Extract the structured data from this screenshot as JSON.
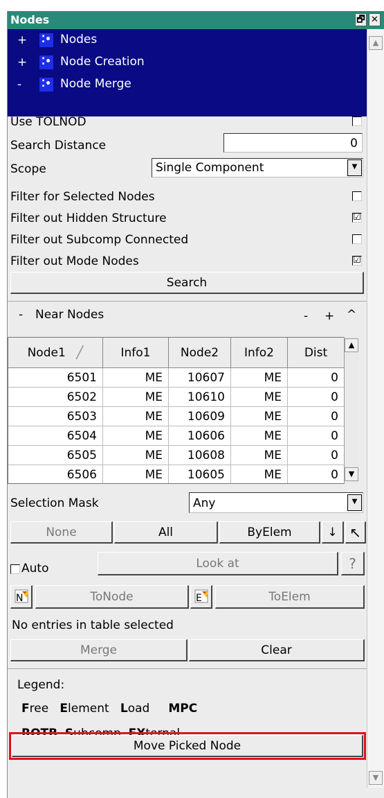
{
  "title": "Nodes",
  "title_buttons": {
    "restore": "🗗",
    "close": "✕"
  },
  "tree": [
    {
      "sign": "+",
      "label": "Nodes"
    },
    {
      "sign": "+",
      "label": "Node Creation"
    },
    {
      "sign": "-",
      "label": "Node Merge"
    }
  ],
  "options": {
    "use_tolnod": {
      "label": "Use TOLNOD",
      "checked": false
    },
    "search_distance": {
      "label": "Search Distance",
      "value": "0"
    },
    "scope": {
      "label": "Scope",
      "value": "Single Component"
    },
    "filter_selected": {
      "label": "Filter for Selected Nodes",
      "checked": false
    },
    "filter_hidden": {
      "label": "Filter out Hidden Structure",
      "checked": true,
      "mark": "☑"
    },
    "filter_subcomp": {
      "label": "Filter out Subcomp Connected",
      "checked": false
    },
    "filter_mode": {
      "label": "Filter out Mode Nodes",
      "checked": true,
      "mark": "☑"
    }
  },
  "search_button": "Search",
  "near_nodes": {
    "label": "Near Nodes",
    "collapse": "-",
    "controls": {
      "minus": "-",
      "plus": "+",
      "up": "^"
    },
    "columns": [
      "Node1",
      "Info1",
      "Node2",
      "Info2",
      "Dist"
    ],
    "rows": [
      [
        "6501",
        "ME",
        "10607",
        "ME",
        "0"
      ],
      [
        "6502",
        "ME",
        "10610",
        "ME",
        "0"
      ],
      [
        "6503",
        "ME",
        "10609",
        "ME",
        "0"
      ],
      [
        "6504",
        "ME",
        "10606",
        "ME",
        "0"
      ],
      [
        "6505",
        "ME",
        "10608",
        "ME",
        "0"
      ],
      [
        "6506",
        "ME",
        "10605",
        "ME",
        "0"
      ]
    ]
  },
  "selection_mask": {
    "label": "Selection Mask",
    "value": "Any"
  },
  "select_buttons": {
    "none": "None",
    "all": "All",
    "byelem": "ByElem",
    "arrow": "↓",
    "pick": "↖"
  },
  "auto": {
    "label": "Auto",
    "checked": false
  },
  "look_at": "Look at",
  "help": "?",
  "to_node": "ToNode",
  "to_elem": "ToElem",
  "selection_status": "No entries in table selected",
  "merge": "Merge",
  "clear": "Clear",
  "legend": {
    "title": "Legend:",
    "line1": [
      {
        "b": "F",
        "r": "ree"
      },
      {
        "b": "E",
        "r": "lement"
      },
      {
        "b": "L",
        "r": "oad"
      },
      {
        "b": "MPC",
        "r": ""
      }
    ],
    "line2": [
      {
        "b": "ROTB",
        "r": ""
      },
      {
        "b": "S",
        "r": "ubcomp"
      },
      {
        "b": "EX",
        "r": "ternal"
      }
    ]
  },
  "move_picked_node": "Move Picked Node",
  "colors": {
    "titlebar": "#2a8a7a",
    "tree_bg": "#0a0a84",
    "highlight": "#e0141a"
  }
}
